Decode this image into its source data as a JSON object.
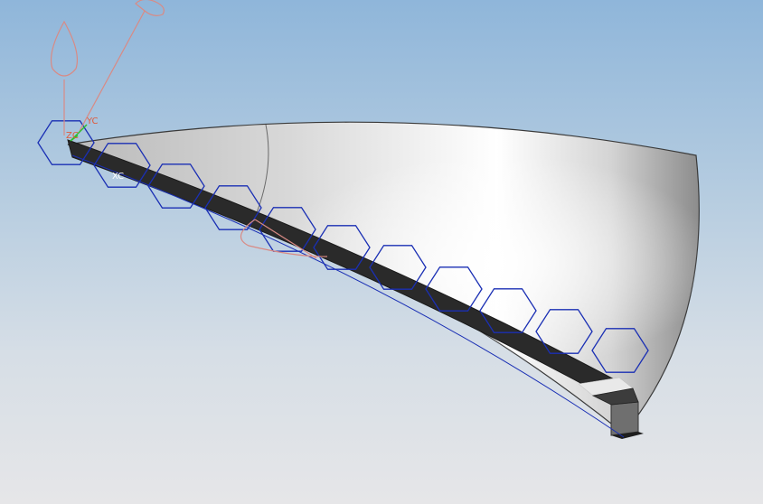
{
  "viewport": {
    "background_top": "#8fb6da",
    "background_bottom": "#e6e6e8"
  },
  "csys": {
    "x_label": "XC",
    "y_label": "YC",
    "z_label": "ZC",
    "x_color": "#ffffff",
    "y_color": "#e05a3a",
    "z_color": "#e05a3a",
    "origin_color": "#2fbf2f"
  },
  "colors": {
    "hexagon_curve": "#1a2fb4",
    "manipulator": "#d98a84",
    "strip": "#2a2a2a",
    "surface_light": "#ffffff",
    "surface_dark": "#8c8c8c",
    "surface_edge": "#3a3a3a"
  },
  "icons": {
    "manipulator_handle": "cone-handle-icon",
    "manipulator_rotate": "rotate-handle-icon"
  }
}
